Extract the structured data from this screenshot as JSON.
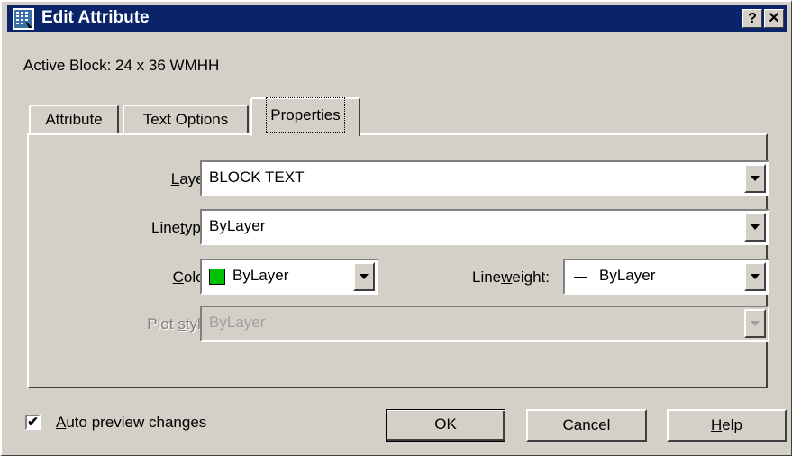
{
  "window": {
    "title": "Edit Attribute",
    "help_button": "?",
    "close_button": "✕"
  },
  "active_block": "Active Block: 24 x 36 WMHH",
  "tabs": [
    {
      "label": "Attribute"
    },
    {
      "label": "Text Options"
    },
    {
      "label": "Properties",
      "active": true
    }
  ],
  "properties": {
    "layer": {
      "label": "Layer:",
      "value": "BLOCK TEXT"
    },
    "linetype": {
      "label": "Linetype:",
      "value": "ByLayer"
    },
    "color": {
      "label": "Color:",
      "value": "ByLayer",
      "swatch_color": "#00c000"
    },
    "lineweight": {
      "label": "Lineweight:",
      "value": "ByLayer"
    },
    "plot_style": {
      "label": "Plot style:",
      "value": "ByLayer",
      "disabled": true
    }
  },
  "auto_preview": {
    "label": "Auto preview changes",
    "checked": true,
    "mark": "✔"
  },
  "buttons": {
    "ok": "OK",
    "cancel": "Cancel",
    "help": "Help"
  },
  "colors": {
    "titlebar": "#0a246a",
    "face": "#d4d0c8"
  }
}
